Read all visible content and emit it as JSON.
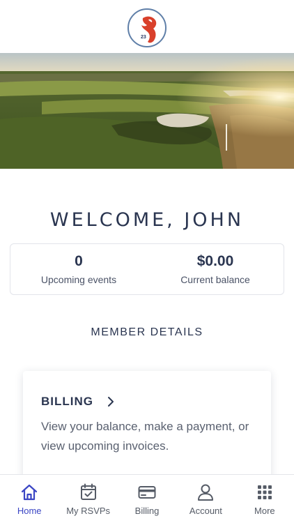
{
  "header": {
    "logo_number": "23"
  },
  "welcome": {
    "title": "WELCOME, JOHN"
  },
  "stats": [
    {
      "value": "0",
      "label": "Upcoming events"
    },
    {
      "value": "$0.00",
      "label": "Current balance"
    }
  ],
  "member_details": {
    "title": "MEMBER DETAILS"
  },
  "billing_card": {
    "title": "BILLING",
    "description": "View your balance, make a payment, or view upcoming invoices."
  },
  "tabbar": {
    "active": "Home",
    "items": [
      {
        "label": "Home",
        "icon": "home-icon"
      },
      {
        "label": "My RSVPs",
        "icon": "calendar-check-icon"
      },
      {
        "label": "Billing",
        "icon": "credit-card-icon"
      },
      {
        "label": "Account",
        "icon": "user-icon"
      },
      {
        "label": "More",
        "icon": "grid-icon"
      }
    ]
  },
  "colors": {
    "accent": "#3a45c4",
    "text": "#2a3550",
    "logo_red": "#d9402b"
  }
}
